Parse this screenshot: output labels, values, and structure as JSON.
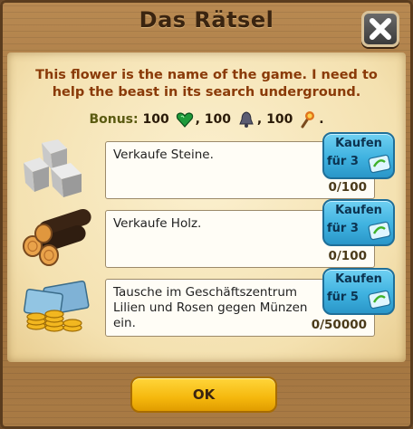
{
  "dialog": {
    "title": "Das Rätsel",
    "intro": "This flower is the name of the game. I need to help the beast in its search underground."
  },
  "bonus": {
    "label": "Bonus:",
    "items": [
      {
        "value": "100",
        "icon": "heart-gem-icon",
        "sep": ","
      },
      {
        "value": "100",
        "icon": "bell-icon",
        "sep": ","
      },
      {
        "value": "100",
        "icon": "torch-icon",
        "sep": "."
      }
    ]
  },
  "tasks": [
    {
      "icon": "stones-icon",
      "description": "Verkaufe Steine.",
      "progress": "0/100",
      "buy": {
        "label": "Kaufen",
        "price_prefix": "für",
        "price": "3",
        "currency_icon": "ticket-icon"
      }
    },
    {
      "icon": "wood-logs-icon",
      "description": "Verkaufe Holz.",
      "progress": "0/100",
      "buy": {
        "label": "Kaufen",
        "price_prefix": "für",
        "price": "3",
        "currency_icon": "ticket-icon"
      }
    },
    {
      "icon": "coins-icon",
      "description": "Tausche im Geschäftszentrum Lilien und Rosen gegen Münzen ein.",
      "progress": "0/50000",
      "buy": {
        "label": "Kaufen",
        "price_prefix": "für",
        "price": "5",
        "currency_icon": "ticket-icon"
      }
    }
  ],
  "ok_label": "OK"
}
